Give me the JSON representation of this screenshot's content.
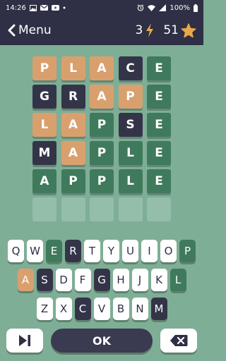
{
  "status_bar": {
    "time": "14:26",
    "battery": "100%",
    "icons": [
      "picture-icon",
      "mail-icon",
      "youtube-icon",
      "dot-icon",
      "alarm-icon",
      "wifi-icon",
      "signal-icon",
      "battery-icon"
    ]
  },
  "header": {
    "back_icon": "chevron-left-icon",
    "menu_label": "Menu",
    "energy_count": "3",
    "energy_icon": "lightning-icon",
    "star_count": "51",
    "star_icon": "star-icon"
  },
  "colors": {
    "background": "#7fae96",
    "dark": "#2f2f45",
    "correct": "#3f7a5c",
    "present": "#d9a06e",
    "absent": "#343449",
    "empty": "#94bea9",
    "key_unused": "#ffffff"
  },
  "board": {
    "rows": [
      [
        {
          "l": "P",
          "s": "present"
        },
        {
          "l": "L",
          "s": "present"
        },
        {
          "l": "A",
          "s": "present"
        },
        {
          "l": "C",
          "s": "absent"
        },
        {
          "l": "E",
          "s": "correct"
        }
      ],
      [
        {
          "l": "G",
          "s": "absent"
        },
        {
          "l": "R",
          "s": "absent"
        },
        {
          "l": "A",
          "s": "present"
        },
        {
          "l": "P",
          "s": "present"
        },
        {
          "l": "E",
          "s": "correct"
        }
      ],
      [
        {
          "l": "L",
          "s": "present"
        },
        {
          "l": "A",
          "s": "present"
        },
        {
          "l": "P",
          "s": "correct"
        },
        {
          "l": "S",
          "s": "absent"
        },
        {
          "l": "E",
          "s": "correct"
        }
      ],
      [
        {
          "l": "M",
          "s": "absent"
        },
        {
          "l": "A",
          "s": "present"
        },
        {
          "l": "P",
          "s": "correct"
        },
        {
          "l": "L",
          "s": "correct"
        },
        {
          "l": "E",
          "s": "correct"
        }
      ],
      [
        {
          "l": "A",
          "s": "correct"
        },
        {
          "l": "P",
          "s": "correct"
        },
        {
          "l": "P",
          "s": "correct"
        },
        {
          "l": "L",
          "s": "correct"
        },
        {
          "l": "E",
          "s": "correct"
        }
      ],
      [
        {
          "l": "",
          "s": "empty"
        },
        {
          "l": "",
          "s": "empty"
        },
        {
          "l": "",
          "s": "empty"
        },
        {
          "l": "",
          "s": "empty"
        },
        {
          "l": "",
          "s": "empty"
        }
      ]
    ]
  },
  "keyboard": {
    "rows": [
      [
        {
          "k": "Q",
          "s": "unused"
        },
        {
          "k": "W",
          "s": "unused"
        },
        {
          "k": "E",
          "s": "correct"
        },
        {
          "k": "R",
          "s": "absent"
        },
        {
          "k": "T",
          "s": "unused"
        },
        {
          "k": "Y",
          "s": "unused"
        },
        {
          "k": "U",
          "s": "unused"
        },
        {
          "k": "I",
          "s": "unused"
        },
        {
          "k": "O",
          "s": "unused"
        },
        {
          "k": "P",
          "s": "correct"
        }
      ],
      [
        {
          "k": "A",
          "s": "present"
        },
        {
          "k": "S",
          "s": "absent"
        },
        {
          "k": "D",
          "s": "unused"
        },
        {
          "k": "F",
          "s": "unused"
        },
        {
          "k": "G",
          "s": "absent"
        },
        {
          "k": "H",
          "s": "unused"
        },
        {
          "k": "J",
          "s": "unused"
        },
        {
          "k": "K",
          "s": "unused"
        },
        {
          "k": "L",
          "s": "correct"
        }
      ],
      [
        {
          "k": "Z",
          "s": "unused"
        },
        {
          "k": "X",
          "s": "unused"
        },
        {
          "k": "C",
          "s": "absent"
        },
        {
          "k": "V",
          "s": "unused"
        },
        {
          "k": "B",
          "s": "unused"
        },
        {
          "k": "N",
          "s": "unused"
        },
        {
          "k": "M",
          "s": "absent"
        }
      ]
    ]
  },
  "actions": {
    "skip_icon": "skip-forward-icon",
    "ok_label": "OK",
    "delete_icon": "backspace-icon"
  }
}
